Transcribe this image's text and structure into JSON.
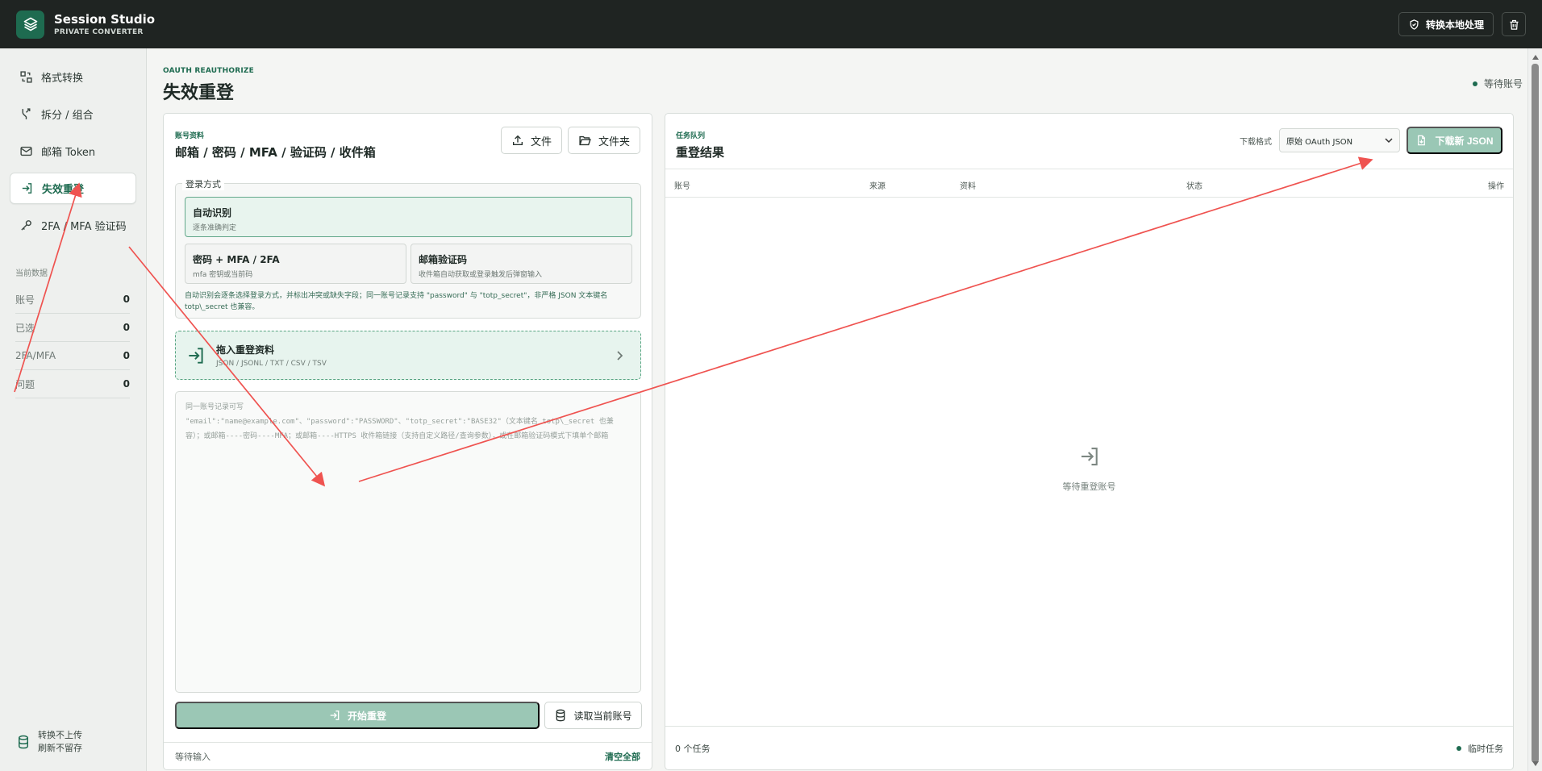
{
  "app": {
    "title": "Session Studio",
    "subtitle": "PRIVATE CONVERTER",
    "local_button": "转换本地处理",
    "accent": "#1e6b50"
  },
  "sidebar": {
    "items": [
      {
        "label": "格式转换",
        "icon": "convert-icon"
      },
      {
        "label": "拆分 / 组合",
        "icon": "branch-icon"
      },
      {
        "label": "邮箱 Token",
        "icon": "mail-icon"
      },
      {
        "label": "失效重登",
        "icon": "login-icon"
      },
      {
        "label": "2FA / MFA 验证码",
        "icon": "key-icon"
      }
    ],
    "stats": {
      "title": "当前数据",
      "rows": [
        {
          "label": "账号",
          "value": "0"
        },
        {
          "label": "已选",
          "value": "0"
        },
        {
          "label": "2FA/MFA",
          "value": "0"
        },
        {
          "label": "问题",
          "value": "0"
        }
      ]
    },
    "footer": {
      "line1": "转换不上传",
      "line2": "刷新不留存"
    }
  },
  "page": {
    "eyebrow": "OAUTH REAUTHORIZE",
    "title": "失效重登",
    "status": "等待账号"
  },
  "left_panel": {
    "eyebrow": "账号资料",
    "title": "邮箱 / 密码 / MFA / 验证码 / 收件箱",
    "buttons": {
      "file": "文件",
      "folder": "文件夹"
    },
    "login_mode": {
      "legend": "登录方式",
      "auto_title": "自动识别",
      "auto_desc": "逐条准确判定",
      "mfa_title": "密码 + MFA / 2FA",
      "mfa_desc": "mfa 密钥或当前码",
      "mail_title": "邮箱验证码",
      "mail_desc": "收件箱自动获取或登录触发后弹窗输入",
      "note": "自动识别会逐条选择登录方式，并标出冲突或缺失字段；同一账号记录支持 \"password\" 与 \"totp_secret\"，非严格 JSON 文本键名 totp\\_secret 也兼容。"
    },
    "dropzone": {
      "title": "拖入重登资料",
      "formats": "JSON / JSONL / TXT / CSV / TSV"
    },
    "textarea_placeholder": "同一账号记录可写\n\"email\":\"name@example.com\"、\"password\":\"PASSWORD\"、\"totp_secret\":\"BASE32\"（文本键名 totp\\_secret 也兼容）；或邮箱----密码----MFA；或邮箱----HTTPS 收件箱链接（支持自定义路径/查询参数），或在邮箱验证码模式下填单个邮箱",
    "start_button": "开始重登",
    "read_button": "读取当前账号",
    "footer_status": "等待输入",
    "clear_all": "清空全部"
  },
  "right_panel": {
    "eyebrow": "任务队列",
    "title": "重登结果",
    "download_label": "下载格式",
    "download_select": "原始 OAuth JSON",
    "download_button": "下载新 JSON",
    "columns": [
      "账号",
      "来源",
      "资料",
      "状态",
      "操作"
    ],
    "empty_text": "等待重登账号",
    "footer_count": "0 个任务",
    "footer_status": "临时任务"
  },
  "annotation_color": "#ef5350"
}
